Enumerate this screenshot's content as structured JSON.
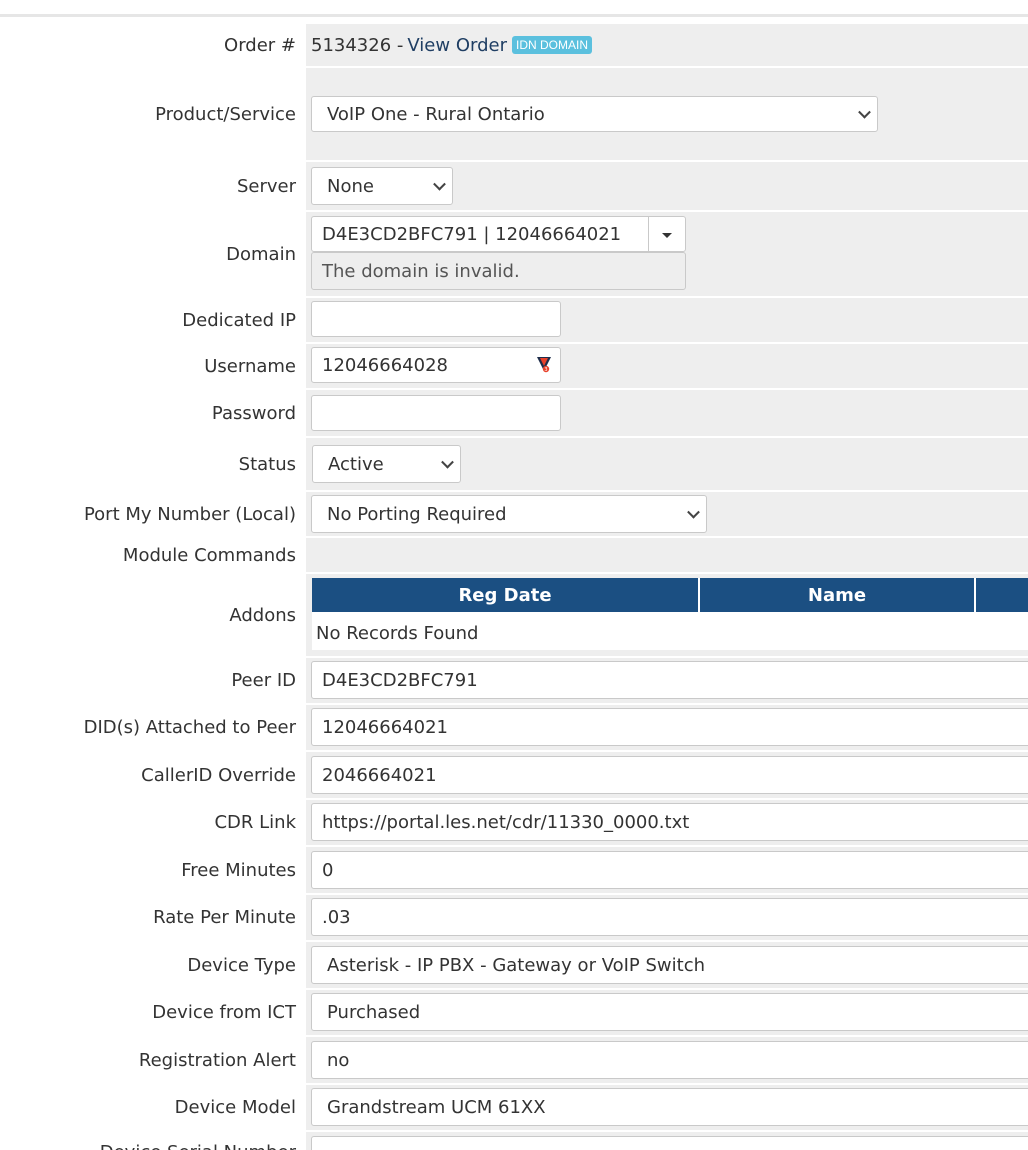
{
  "order": {
    "label": "Order #",
    "number": "5134326 -",
    "view_link": "View Order",
    "badge": "IDN DOMAIN"
  },
  "fields": {
    "product_service": {
      "label": "Product/Service",
      "value": "VoIP One - Rural Ontario"
    },
    "server": {
      "label": "Server",
      "value": "None"
    },
    "domain": {
      "label": "Domain",
      "value": "D4E3CD2BFC791 | 12046664021",
      "error": "The domain is invalid."
    },
    "dedicated_ip": {
      "label": "Dedicated IP",
      "value": ""
    },
    "username": {
      "label": "Username",
      "value": "12046664028"
    },
    "password": {
      "label": "Password",
      "value": ""
    },
    "status": {
      "label": "Status",
      "value": "Active"
    },
    "port_my_number": {
      "label": "Port My Number (Local)",
      "value": "No Porting Required"
    },
    "module_commands": {
      "label": "Module Commands"
    },
    "addons": {
      "label": "Addons",
      "columns": [
        "Reg Date",
        "Name",
        ""
      ],
      "empty": "No Records Found"
    },
    "peer_id": {
      "label": "Peer ID",
      "value": "D4E3CD2BFC791"
    },
    "dids": {
      "label": "DID(s) Attached to Peer",
      "value": "12046664021"
    },
    "callerid": {
      "label": "CallerID Override",
      "value": "2046664021"
    },
    "cdr_link": {
      "label": "CDR Link",
      "value": "https://portal.les.net/cdr/11330_0000.txt"
    },
    "free_minutes": {
      "label": "Free Minutes",
      "value": "0"
    },
    "rate_per_minute": {
      "label": "Rate Per Minute",
      "value": ".03"
    },
    "device_type": {
      "label": "Device Type",
      "value": "Asterisk - IP PBX - Gateway or VoIP Switch"
    },
    "device_from_ict": {
      "label": "Device from ICT",
      "value": "Purchased"
    },
    "registration_alert": {
      "label": "Registration Alert",
      "value": "no"
    },
    "device_model": {
      "label": "Device Model",
      "value": "Grandstream UCM 61XX"
    },
    "device_serial": {
      "label": "Device Serial Number",
      "value": ""
    }
  }
}
